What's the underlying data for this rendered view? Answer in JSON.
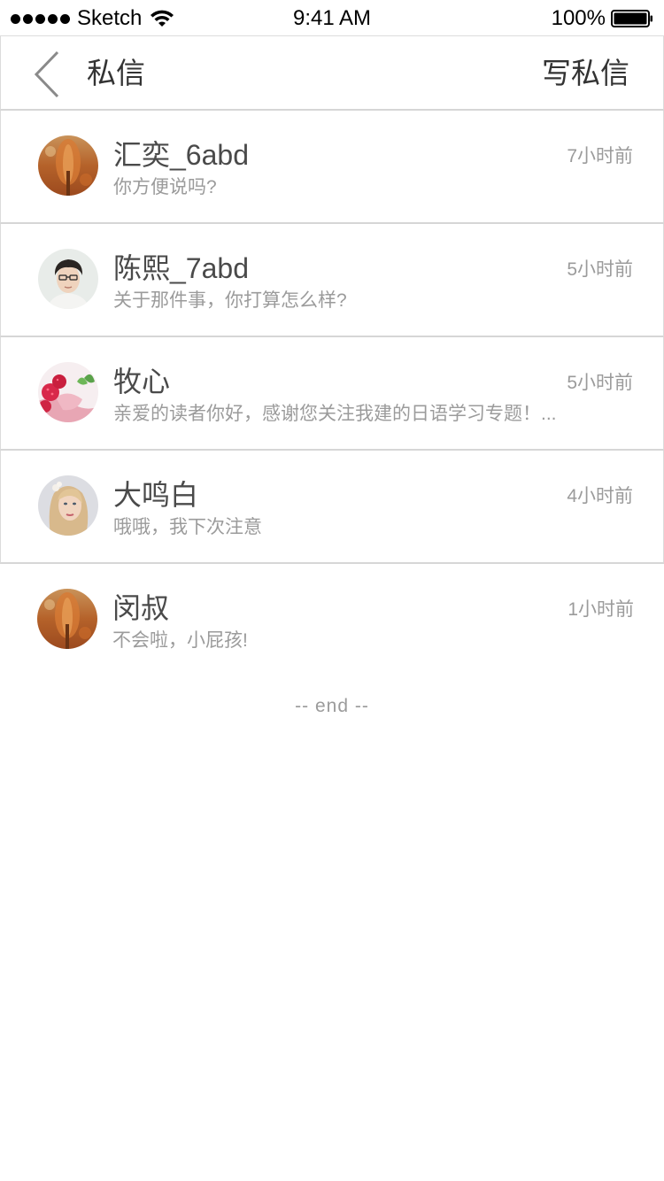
{
  "status_bar": {
    "carrier": "Sketch",
    "time": "9:41 AM",
    "battery": "100%",
    "icons": [
      "signal-dots-icon",
      "wifi-icon",
      "battery-icon"
    ]
  },
  "header": {
    "back_icon": "chevron-left-icon",
    "title": "私信",
    "compose_label": "写私信"
  },
  "messages": [
    {
      "name": "汇奕_6abd",
      "preview": "你方便说吗?",
      "time": "7小时前",
      "avatar": "avatar-autumn-tree"
    },
    {
      "name": "陈熙_7abd",
      "preview": "关于那件事，你打算怎么样?",
      "time": "5小时前",
      "avatar": "avatar-young-man"
    },
    {
      "name": "牧心",
      "preview": "亲爱的读者你好，感谢您关注我建的日语学习专题！...",
      "time": "5小时前",
      "avatar": "avatar-raspberry-dessert"
    },
    {
      "name": "大鸣白",
      "preview": "哦哦，我下次注意",
      "time": "4小时前",
      "avatar": "avatar-blonde-woman"
    },
    {
      "name": "闵叔",
      "preview": "不会啦，小屁孩!",
      "time": "1小时前",
      "avatar": "avatar-autumn-tree"
    }
  ],
  "footer": {
    "end_label": "-- end --"
  },
  "colors": {
    "name": "#4a4a4a",
    "secondary": "#9b9b9b",
    "divider": "#d6d6d6"
  }
}
